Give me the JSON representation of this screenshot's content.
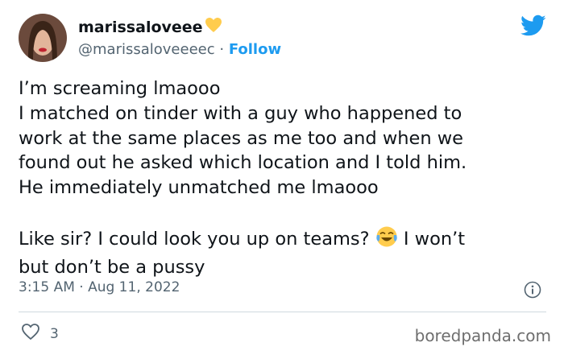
{
  "author": {
    "display_name": "marissaloveee",
    "badge_icon": "yellow-heart-icon",
    "handle": "@marissaloveeeec",
    "separator": "·",
    "follow_label": "Follow"
  },
  "tweet": {
    "lines": [
      "I’m screaming lmaooo",
      "I matched on tinder with a guy who happened to",
      "work at the same places as me too and when we",
      "found out he asked which location and I told him.",
      "He immediately unmatched me lmaooo",
      "",
      "Like sir? I could look you up on teams?",
      "I won’t",
      "but don’t be a pussy"
    ],
    "emoji": "face-with-tears-of-joy"
  },
  "meta": {
    "timestamp": "3:15 AM · Aug 11, 2022"
  },
  "engagement": {
    "like_count": "3"
  },
  "watermark": "boredpanda.com",
  "colors": {
    "accent": "#1d9bf0",
    "text": "#0f1419",
    "secondary": "#536471",
    "heart_badge": "#ffcc4d"
  }
}
